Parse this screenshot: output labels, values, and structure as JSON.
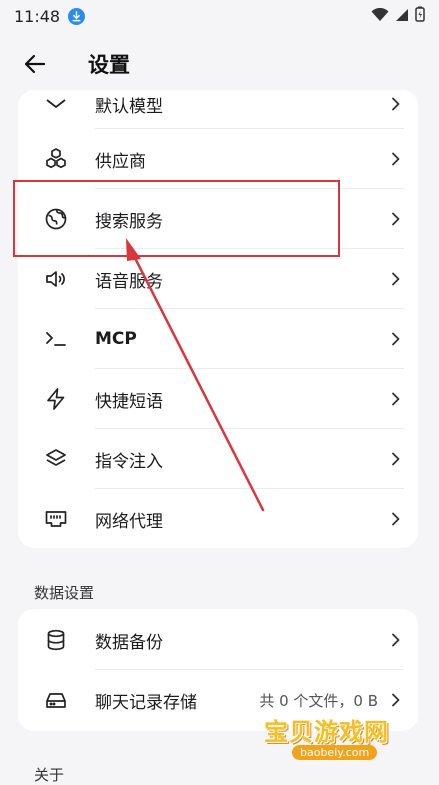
{
  "status_bar": {
    "time": "11:48"
  },
  "app_bar": {
    "title": "设置"
  },
  "settings_group": {
    "items": [
      {
        "label": "默认模型",
        "icon": "model-icon"
      },
      {
        "label": "供应商",
        "icon": "cubes-icon"
      },
      {
        "label": "搜索服务",
        "icon": "globe-icon"
      },
      {
        "label": "语音服务",
        "icon": "speaker-icon"
      },
      {
        "label": "MCP",
        "icon": "terminal-icon"
      },
      {
        "label": "快捷短语",
        "icon": "lightning-icon"
      },
      {
        "label": "指令注入",
        "icon": "layers-icon"
      },
      {
        "label": "网络代理",
        "icon": "router-icon"
      }
    ]
  },
  "data_section": {
    "title": "数据设置",
    "items": [
      {
        "label": "数据备份",
        "icon": "database-icon"
      },
      {
        "label": "聊天记录存储",
        "icon": "drive-icon",
        "value": "共 0 个文件，0 B"
      }
    ]
  },
  "about_section": {
    "title": "关于"
  },
  "watermark": {
    "title": "宝贝游戏网",
    "url": "baobeiy.com"
  },
  "colors": {
    "annotation": "#d9363e",
    "accent": "#2a8cf0"
  }
}
